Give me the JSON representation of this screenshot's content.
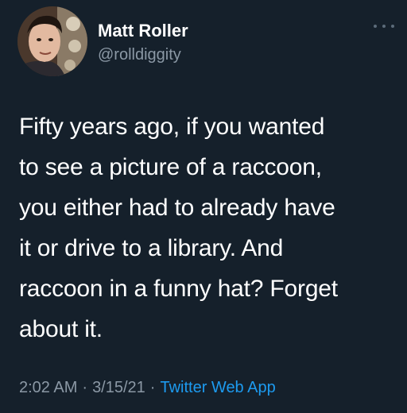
{
  "tweet": {
    "author": {
      "display_name": "Matt Roller",
      "handle": "@rolldiggity",
      "avatar_icon": "profile-photo"
    },
    "more_icon": "more-options-icon",
    "text_lines": [
      "Fifty years ago, if you wanted",
      "to see a picture of a raccoon,",
      "you either had to already have",
      "it or drive to a library. And",
      "raccoon in a funny hat? Forget",
      "about it."
    ],
    "meta": {
      "time": "2:02 AM",
      "separator": "·",
      "date": "3/15/21",
      "source": "Twitter Web App"
    }
  },
  "colors": {
    "background": "#15202b",
    "text_primary": "#ffffff",
    "text_secondary": "#8b98a5",
    "link": "#1d9bf0"
  }
}
